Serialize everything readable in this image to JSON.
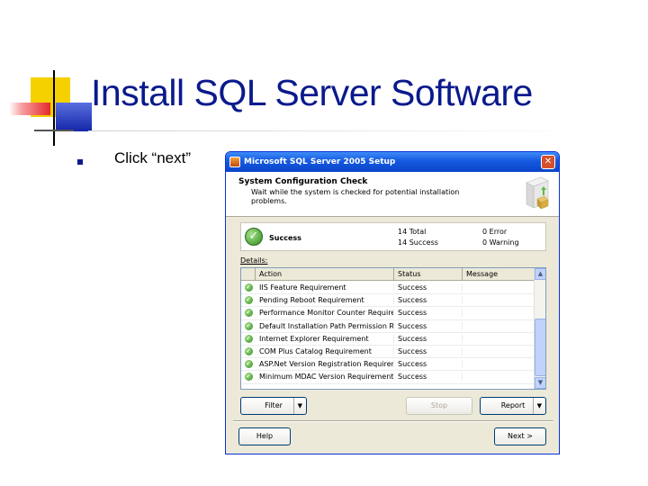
{
  "slide": {
    "title": "Install SQL Server Software",
    "bullet": "Click “next”"
  },
  "window": {
    "title": "Microsoft SQL Server 2005 Setup",
    "close_glyph": "✕",
    "header_title": "System Configuration Check",
    "header_subtitle": "Wait while the system is checked for potential installation problems.",
    "summary": {
      "status": "Success",
      "total": "14 Total",
      "success": "14 Success",
      "error": "0 Error",
      "warning": "0 Warning"
    },
    "details_label": "Details:",
    "columns": {
      "action": "Action",
      "status": "Status",
      "message": "Message"
    },
    "rows": [
      {
        "action": "IIS Feature Requirement",
        "status": "Success",
        "message": ""
      },
      {
        "action": "Pending Reboot Requirement",
        "status": "Success",
        "message": ""
      },
      {
        "action": "Performance Monitor Counter Requireme...",
        "status": "Success",
        "message": ""
      },
      {
        "action": "Default Installation Path Permission Re...",
        "status": "Success",
        "message": ""
      },
      {
        "action": "Internet Explorer Requirement",
        "status": "Success",
        "message": ""
      },
      {
        "action": "COM Plus Catalog Requirement",
        "status": "Success",
        "message": ""
      },
      {
        "action": "ASP.Net Version Registration Requireme...",
        "status": "Success",
        "message": ""
      },
      {
        "action": "Minimum MDAC Version Requirement",
        "status": "Success",
        "message": ""
      }
    ],
    "buttons": {
      "filter": "Filter",
      "stop": "Stop",
      "report": "Report",
      "help": "Help",
      "next": "Next >"
    }
  },
  "colors": {
    "title_blue": "#0a1a8c",
    "xp_titlebar": "#1459e0",
    "success_green": "#2e8a1f"
  },
  "icons": [
    "success-check-icon",
    "server-box-icon",
    "window-app-icon",
    "close-icon",
    "dropdown-arrow-icon"
  ]
}
